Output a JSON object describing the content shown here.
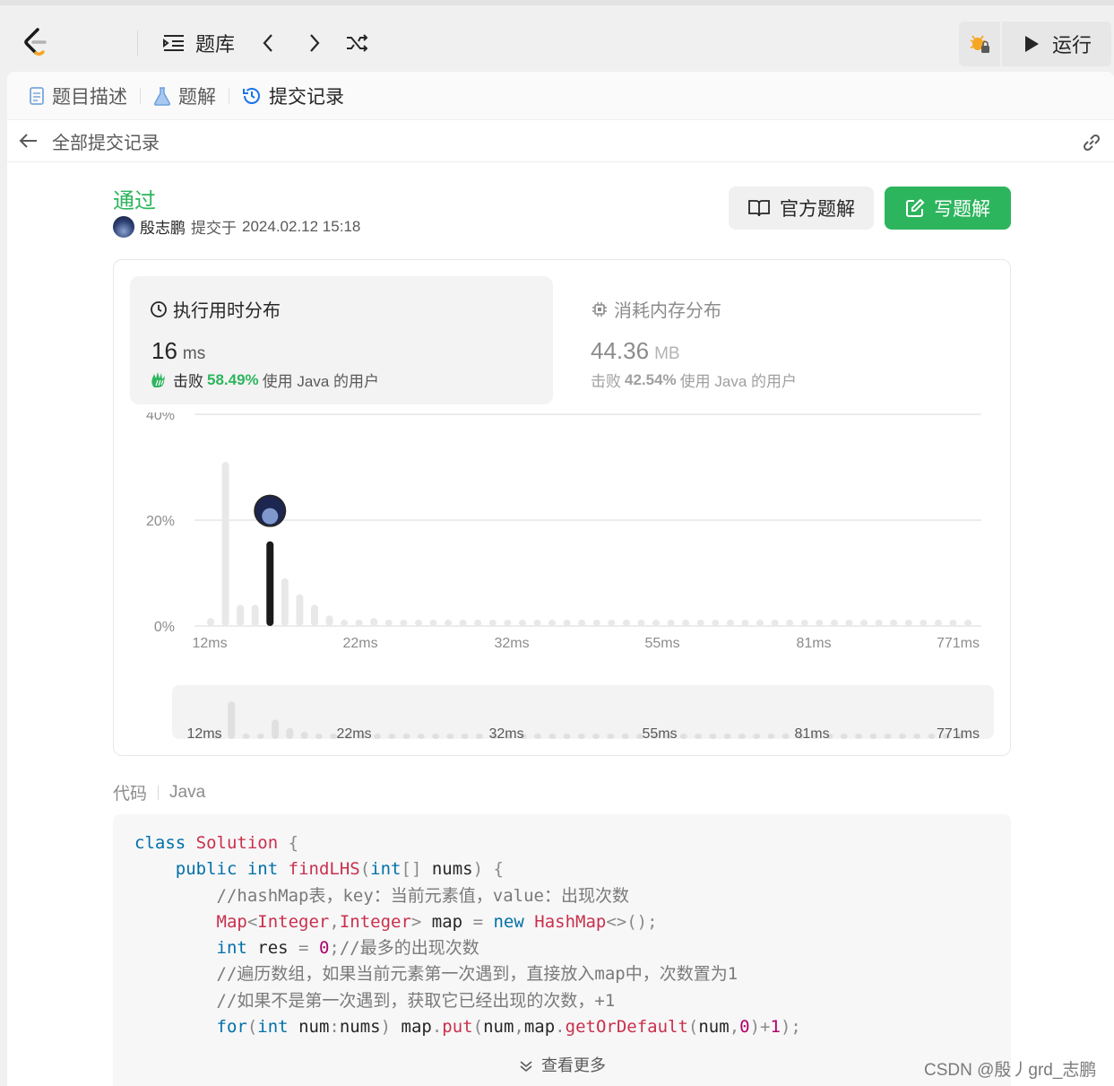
{
  "topbar": {
    "problem_bank_label": "题库",
    "run_label": "运行"
  },
  "tabs": [
    {
      "label": "题目描述",
      "icon": "document-icon"
    },
    {
      "label": "题解",
      "icon": "flask-icon"
    },
    {
      "label": "提交记录",
      "icon": "history-icon"
    }
  ],
  "subhead": {
    "back_label": "全部提交记录"
  },
  "submission": {
    "status": "通过",
    "user": "殷志鹏",
    "submitted_prefix": "提交于",
    "time": "2024.02.12 15:18"
  },
  "buttons": {
    "official_solution": "官方题解",
    "write_solution": "写题解"
  },
  "runtime": {
    "title": "执行用时分布",
    "value": "16",
    "unit": "ms",
    "beat_prefix": "击败",
    "beat_pct": "58.49%",
    "beat_suffix": "使用 Java 的用户"
  },
  "memory": {
    "title": "消耗内存分布",
    "value": "44.36",
    "unit": "MB",
    "beat_prefix": "击败",
    "beat_pct": "42.54%",
    "beat_suffix": "使用 Java 的用户"
  },
  "chart_data": {
    "type": "bar",
    "ylim": [
      0,
      40
    ],
    "yticks": [
      "40%",
      "20%",
      "0%"
    ],
    "xticks": [
      "12ms",
      "22ms",
      "32ms",
      "55ms",
      "81ms",
      "771ms"
    ],
    "values": [
      1.5,
      31,
      4,
      4,
      16,
      9,
      6,
      4,
      2,
      1,
      1,
      1.5,
      1,
      1,
      1,
      1,
      1,
      1,
      1,
      1,
      1,
      1,
      1,
      1,
      1,
      1,
      1,
      1,
      1,
      1,
      1,
      1,
      1,
      1,
      1,
      1,
      1,
      1,
      1,
      1,
      1,
      1,
      1,
      1,
      1,
      1,
      1,
      1,
      1,
      1,
      1,
      1
    ],
    "highlight_index": 4,
    "colors": {
      "bar": "#e8e8e8",
      "highlight": "#1a1a1a",
      "grid": "#e6e6e6"
    }
  },
  "code": {
    "label": "代码",
    "language": "Java",
    "lines": [
      "class Solution {",
      "    public int findLHS(int[] nums) {",
      "        //hashMap表，key：当前元素值，value：出现次数",
      "        Map<Integer,Integer> map = new HashMap<>();",
      "        int res = 0;//最多的出现次数",
      "        //遍历数组，如果当前元素第一次遇到，直接放入map中，次数置为1",
      "        //如果不是第一次遇到，获取它已经出现的次数，+1",
      "        for(int num:nums) map.put(num,map.getOrDefault(num,0)+1);"
    ],
    "more_label": "查看更多"
  },
  "watermark": "CSDN @殷丿grd_志鹏"
}
